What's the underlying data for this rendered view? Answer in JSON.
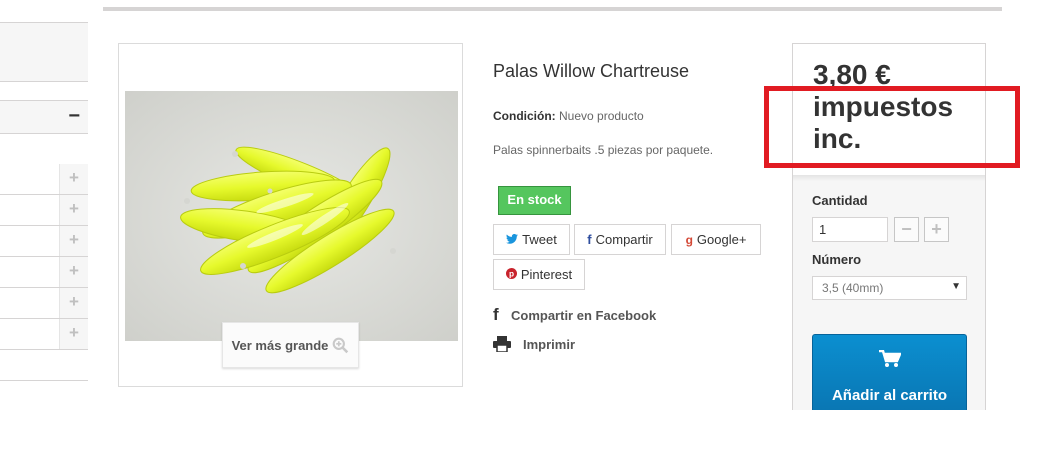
{
  "sidebar": {
    "collapse_symbol": "−",
    "expand_symbol": "+"
  },
  "product": {
    "title": "Palas Willow Chartreuse",
    "condition_label": "Condición:",
    "condition_value": "Nuevo producto",
    "description": "Palas spinnerbaits .5 piezas por paquete.",
    "stock_badge": "En stock",
    "zoom_label": "Ver más grande"
  },
  "share": {
    "tweet": "Tweet",
    "share": "Compartir",
    "google": "Google+",
    "pinterest": "Pinterest",
    "facebook_link": "Compartir en Facebook",
    "print_link": "Imprimir"
  },
  "buy": {
    "price": "3,80 €",
    "tax_note": "impuestos inc.",
    "quantity_label": "Cantidad",
    "quantity_value": "1",
    "number_label": "Número",
    "number_selected": "3,5 (40mm)",
    "add_to_cart": "Añadir al carrito",
    "minus": "−",
    "plus": "+"
  },
  "colors": {
    "accent": "#0a80c4",
    "stock": "#55c65e",
    "highlight": "#e11b22",
    "lure": "#e6f92c"
  }
}
